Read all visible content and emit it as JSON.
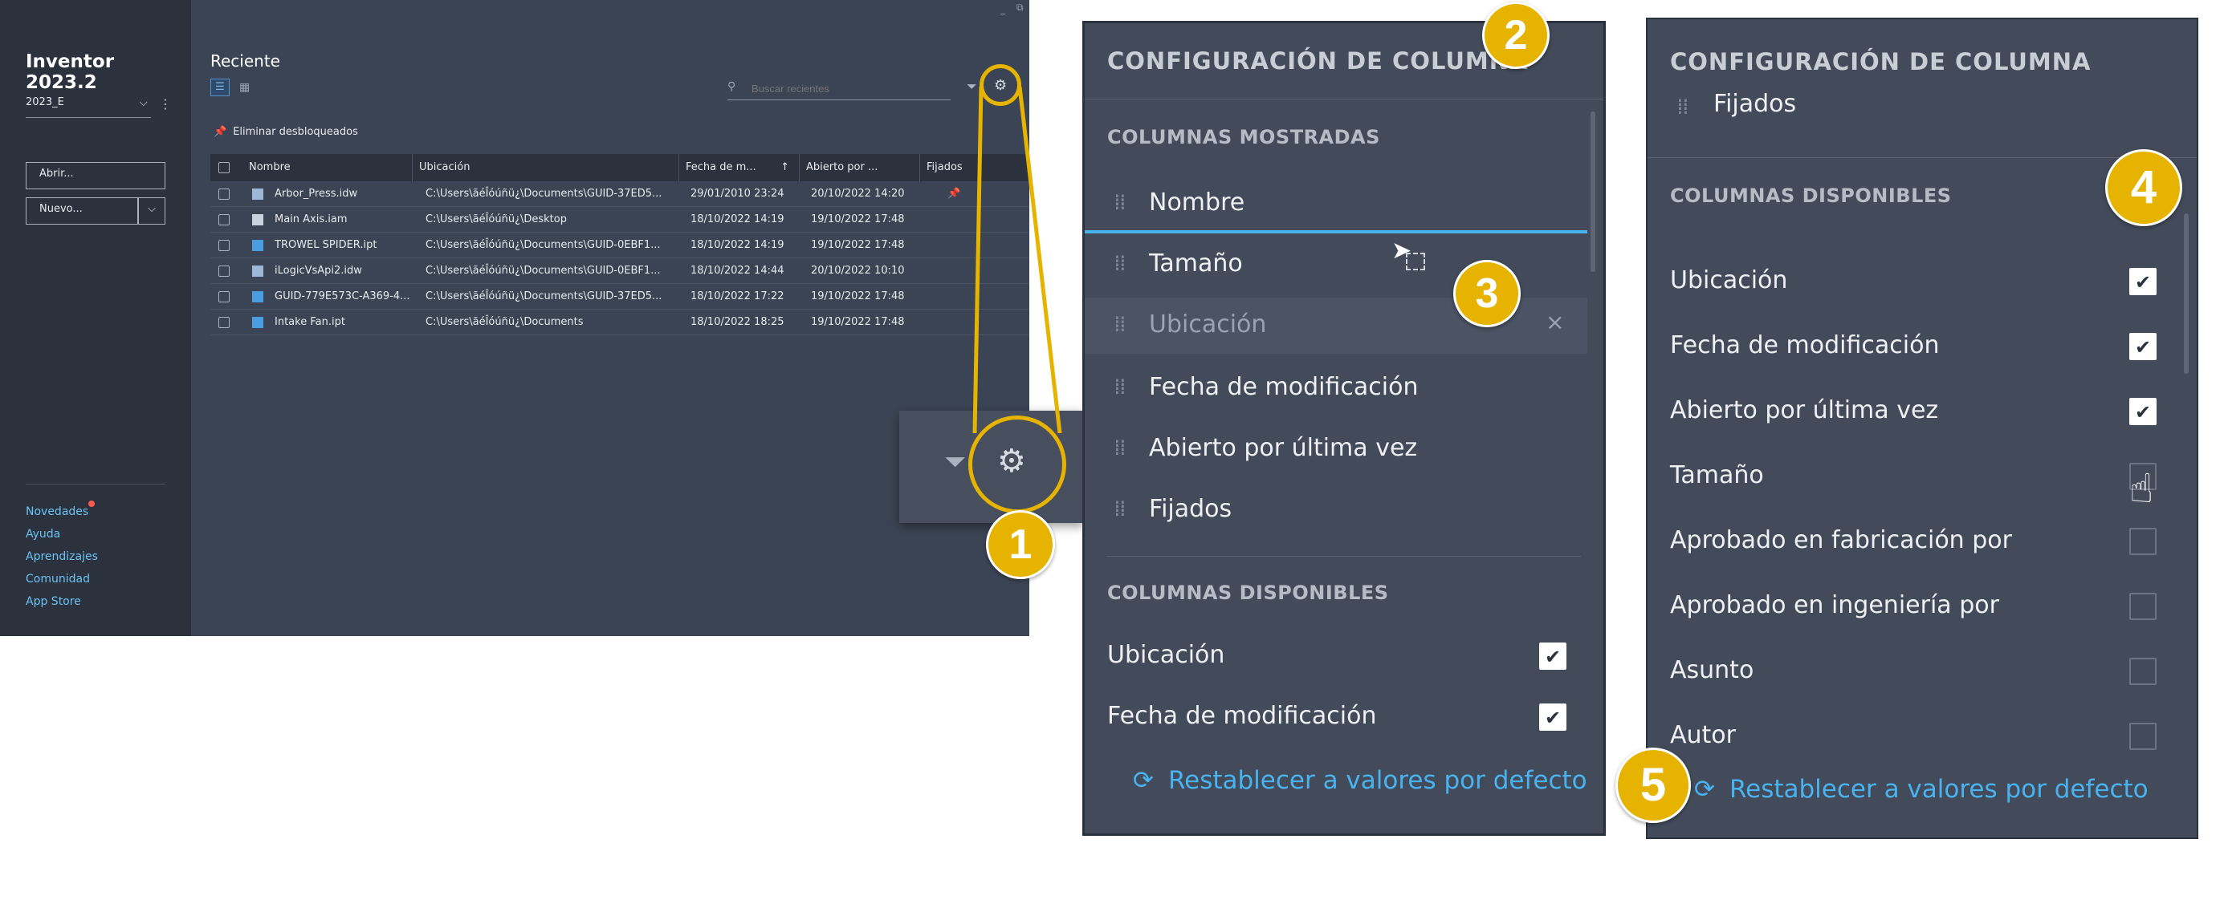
{
  "app": {
    "title": "Inventor 2023.2",
    "project": "2023_E",
    "open_label": "Abrir...",
    "new_label": "Nuevo...",
    "links": [
      "Novedades",
      "Ayuda",
      "Aprendizajes",
      "Comunidad",
      "App Store"
    ]
  },
  "recent": {
    "title": "Reciente",
    "search_placeholder": "Buscar recientes",
    "unpin_label": "Eliminar desbloqueados",
    "columns": [
      "Nombre",
      "Ubicación",
      "Fecha de m...",
      "Abierto por ...",
      "Fijados"
    ],
    "rows": [
      {
        "name": "Arbor_Press.idw",
        "location": "C:\\Users\\ãéÎóúñü¿\\Documents\\GUID-37ED5...",
        "modified": "29/01/2010 23:24",
        "opened": "20/10/2022 14:20",
        "pinned": true,
        "icon": "drawing-icon"
      },
      {
        "name": "Main Axis.iam",
        "location": "C:\\Users\\ãéÎóúñü¿\\Desktop",
        "modified": "18/10/2022 14:19",
        "opened": "19/10/2022 17:48",
        "pinned": false,
        "icon": "assembly-icon"
      },
      {
        "name": "TROWEL SPIDER.ipt",
        "location": "C:\\Users\\ãéÎóúñü¿\\Documents\\GUID-0EBF1...",
        "modified": "18/10/2022 14:19",
        "opened": "19/10/2022 17:48",
        "pinned": false,
        "icon": "part-icon"
      },
      {
        "name": "iLogicVsApi2.idw",
        "location": "C:\\Users\\ãéÎóúñü¿\\Documents\\GUID-0EBF1...",
        "modified": "18/10/2022 14:44",
        "opened": "20/10/2022 10:10",
        "pinned": false,
        "icon": "drawing-icon"
      },
      {
        "name": "GUID-779E573C-A369-4...",
        "location": "C:\\Users\\ãéÎóúñü¿\\Documents\\GUID-37ED5...",
        "modified": "18/10/2022 17:22",
        "opened": "19/10/2022 17:48",
        "pinned": false,
        "icon": "part-icon"
      },
      {
        "name": "Intake Fan.ipt",
        "location": "C:\\Users\\ãéÎóúñü¿\\Documents",
        "modified": "18/10/2022 18:25",
        "opened": "19/10/2022 17:48",
        "pinned": false,
        "icon": "part-icon"
      }
    ]
  },
  "panel_a": {
    "title": "CONFIGURACIÓN DE COLUMNA",
    "shown_header": "COLUMNAS MOSTRADAS",
    "shown": [
      "Nombre",
      "Tamaño",
      "Ubicación",
      "Fecha de modificación",
      "Abierto por última vez",
      "Fijados"
    ],
    "available_header": "COLUMNAS DISPONIBLES",
    "available": [
      {
        "label": "Ubicación",
        "checked": true
      },
      {
        "label": "Fecha de modificación",
        "checked": true
      }
    ],
    "reset_label": "Restablecer a valores por defecto"
  },
  "panel_b": {
    "title": "CONFIGURACIÓN DE COLUMNA",
    "partial_item": "Fijados",
    "available_header": "COLUMNAS DISPONIBLES",
    "available": [
      {
        "label": "Ubicación",
        "checked": true
      },
      {
        "label": "Fecha de modificación",
        "checked": true
      },
      {
        "label": "Abierto por última vez",
        "checked": true
      },
      {
        "label": "Tamaño",
        "checked": false
      },
      {
        "label": "Aprobado en fabricación por",
        "checked": false
      },
      {
        "label": "Aprobado en ingeniería por",
        "checked": false
      },
      {
        "label": "Asunto",
        "checked": false
      },
      {
        "label": "Autor",
        "checked": false
      }
    ],
    "reset_label": "Restablecer a valores por defecto"
  },
  "callouts": [
    "1",
    "2",
    "3",
    "4",
    "5"
  ],
  "colors": {
    "accent": "#e6b400",
    "link": "#49b3f0",
    "panel": "#434b5a",
    "sidebar": "#2b313d"
  }
}
